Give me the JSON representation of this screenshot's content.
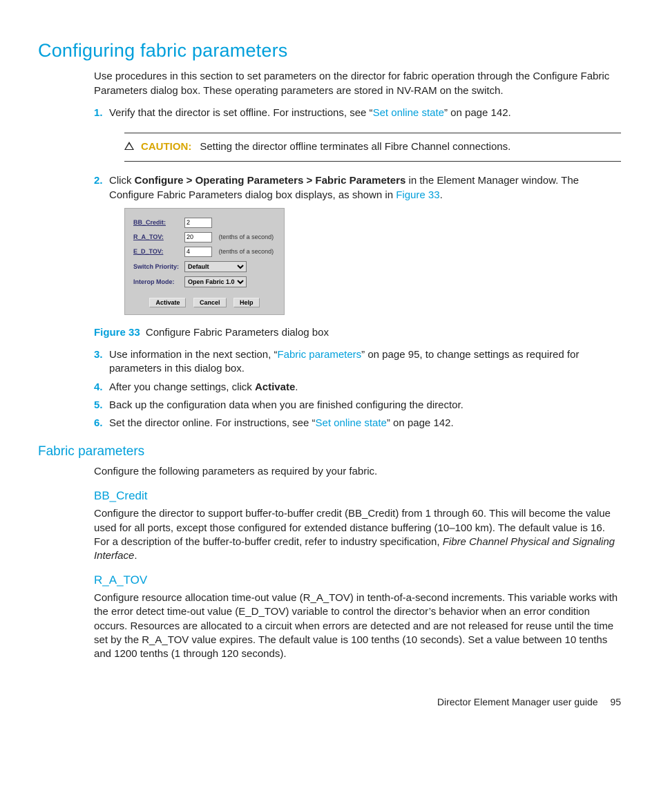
{
  "heading": "Configuring fabric parameters",
  "intro": "Use procedures in this section to set parameters on the director for fabric operation through the Configure Fabric Parameters dialog box. These operating parameters are stored in NV-RAM on the switch.",
  "steps": {
    "s1_num": "1.",
    "s1_a": "Verify that the director is set offline. For instructions, see “",
    "s1_link": "Set online state",
    "s1_b": "” on page 142.",
    "s2_num": "2.",
    "s2_a": "Click ",
    "s2_bold": "Configure > Operating Parameters > Fabric Parameters",
    "s2_b": " in the Element Manager window. The Configure Fabric Parameters dialog box displays, as shown in ",
    "s2_link": "Figure 33",
    "s2_c": ".",
    "s3_num": "3.",
    "s3_a": "Use information in the next section, “",
    "s3_link": "Fabric parameters",
    "s3_b": "” on page 95, to change settings as required for parameters in this dialog box.",
    "s4_num": "4.",
    "s4_a": "After you change settings, click ",
    "s4_bold": "Activate",
    "s4_b": ".",
    "s5_num": "5.",
    "s5": "Back up the configuration data when you are finished configuring the director.",
    "s6_num": "6.",
    "s6_a": "Set the director online. For instructions, see “",
    "s6_link": "Set online state",
    "s6_b": "” on page 142."
  },
  "caution": {
    "label": "CAUTION:",
    "text": "Setting the director offline terminates all Fibre Channel connections."
  },
  "dialog": {
    "rows": {
      "bb_label": "BB_Credit:",
      "bb_value": "2",
      "ra_label": "R_A_TOV:",
      "ra_value": "20",
      "ra_unit": "(tenths of a second)",
      "ed_label": "E_D_TOV:",
      "ed_value": "4",
      "ed_unit": "(tenths of a second)",
      "sp_label": "Switch Priority:",
      "sp_value": "Default",
      "im_label": "Interop Mode:",
      "im_value": "Open Fabric 1.0"
    },
    "buttons": {
      "activate": "Activate",
      "cancel": "Cancel",
      "help": "Help"
    }
  },
  "figure": {
    "label": "Figure 33",
    "caption": " Configure Fabric Parameters dialog box"
  },
  "subheading1": "Fabric parameters",
  "sub1_intro": "Configure the following parameters as required by your fabric.",
  "bb": {
    "heading": "BB_Credit",
    "text_a": "Configure the director to support buffer-to-buffer credit (BB_Credit) from 1 through 60. This will become the value used for all ports, except those configured for extended distance buffering (10–100 km). The default value is 16. For a description of the buffer-to-buffer credit, refer to industry specification, ",
    "text_italic": "Fibre Channel Physical and Signaling Interface",
    "text_b": "."
  },
  "ra": {
    "heading": "R_A_TOV",
    "text": "Configure resource allocation time-out value (R_A_TOV) in tenth-of-a-second increments. This variable works with the error detect time-out value (E_D_TOV) variable to control the director’s behavior when an error condition occurs. Resources are allocated to a circuit when errors are detected and are not released for reuse until the time set by the R_A_TOV value expires. The default value is 100 tenths (10 seconds). Set a value between 10 tenths and 1200 tenths (1 through 120 seconds)."
  },
  "footer": {
    "title": "Director Element Manager user guide",
    "page": "95"
  }
}
